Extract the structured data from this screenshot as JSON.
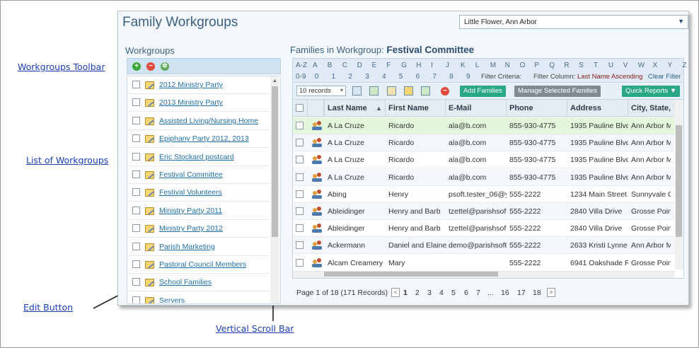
{
  "callouts": {
    "toolbar": "Workgroups Toolbar",
    "list": "List of Workgroups",
    "edit": "Edit Button",
    "scroll": "Vertical Scroll Bar"
  },
  "window": {
    "title": "Family Workgroups",
    "parish": "Little Flower, Ann Arbor"
  },
  "left": {
    "heading": "Workgroups",
    "toolbar_icons": [
      "add-icon",
      "remove-icon",
      "share-icon"
    ],
    "workgroups": [
      "2012 Ministry Party",
      "2013 Ministry Party",
      "Assisted Living/Nursing Home",
      "Epiphany Party 2012, 2013",
      "Eric Stockard postcard",
      "Festival Committee",
      "Festival Volunteers",
      "Ministry Party 2011",
      "Ministry Party 2012",
      "Parish Marketing",
      "Pastoral Council Members",
      "School Families",
      "Servers"
    ]
  },
  "right": {
    "heading_prefix": "Families in Workgroup:",
    "heading_name": "Festival Committee",
    "alpha_row1": [
      "A-Z",
      "A",
      "B",
      "C",
      "D",
      "E",
      "F",
      "G",
      "H",
      "I",
      "J",
      "K",
      "L",
      "M",
      "N",
      "O",
      "P",
      "Q",
      "R",
      "S",
      "T",
      "U",
      "V",
      "W",
      "X",
      "Y",
      "Z"
    ],
    "alpha_row2": [
      "0-9",
      "0",
      "1",
      "2",
      "3",
      "4",
      "5",
      "6",
      "7",
      "8",
      "9"
    ],
    "filter_criteria": "Filter Criteria:",
    "filter_column": "Filter Column:",
    "filter_value": "Last Name Ascending",
    "clear_filter": "Clear Filter",
    "records_select": "10 records",
    "btn_add": "Add Families",
    "btn_manage": "Manage Selected Families",
    "btn_reports": "Quick Reports ▼",
    "colors": {
      "green_btn": "#2aa785",
      "gray_btn": "#7f8a93",
      "highlight_row": "#e4f6dc"
    },
    "columns": [
      "Last Name",
      "First Name",
      "E-Mail",
      "Phone",
      "Address",
      "City, State,"
    ],
    "rows": [
      [
        "A La Cruze",
        "Ricardo",
        "ala@b.com",
        "855-930-4775",
        "1935 Pauline Blvd",
        "Ann Arbor M"
      ],
      [
        "A La Cruze",
        "Ricardo",
        "ala@b.com",
        "855-930-4775",
        "1935 Pauline Blvd",
        "Ann Arbor M"
      ],
      [
        "A La Cruze",
        "Ricardo",
        "ala@b.com",
        "855-930-4775",
        "1935 Pauline Blvd",
        "Ann Arbor M"
      ],
      [
        "A La Cruze",
        "Ricardo",
        "ala@b.com",
        "855-930-4775",
        "1935 Pauline Blvd",
        "Ann Arbor M"
      ],
      [
        "Abing",
        "Henry",
        "psoft.tester_06@y",
        "555-2222",
        "1234 Main Street",
        "Sunnyvale C/"
      ],
      [
        "Ableidinger",
        "Henry and Barb",
        "tzettel@parishsoft",
        "555-2222",
        "2840 Villa Drive",
        "Grosse Point"
      ],
      [
        "Ableidinger",
        "Henry and Barb",
        "tzettel@parishsoft",
        "555-2222",
        "2840 Villa Drive",
        "Grosse Point"
      ],
      [
        "Ackermann",
        "Daniel and Elaine",
        "demo@parishsoft.",
        "555-2222",
        "2633 Kristi Lynne",
        "Ann Arbor M"
      ],
      [
        "Alcam Creamery",
        "Mary",
        "",
        "555-2222",
        "6941 Oakshade R",
        "Grosse Point"
      ]
    ],
    "pager_text": "Page 1 of 18 (171 Records)",
    "pages": [
      "1",
      "2",
      "3",
      "4",
      "5",
      "6",
      "7",
      "...",
      "16",
      "17",
      "18"
    ]
  }
}
